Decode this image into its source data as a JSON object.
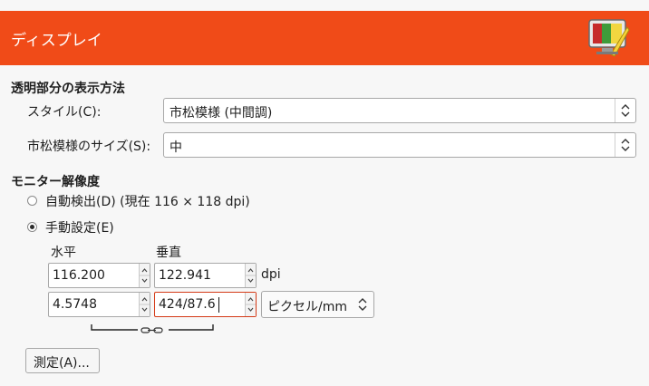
{
  "header": {
    "title": "ディスプレイ",
    "icon": "monitor-color-icon",
    "background": "#f04b18"
  },
  "transparency": {
    "section_title": "透明部分の表示方法",
    "style_label": "スタイル(C):",
    "style_value": "市松模様 (中間調)",
    "size_label": "市松模様のサイズ(S):",
    "size_value": "中"
  },
  "monitor": {
    "section_title": "モニター解像度",
    "auto_detect_label": "自動検出(D) (現在 116 × 118 dpi)",
    "auto_detect_checked": false,
    "manual_label": "手動設定(E)",
    "manual_checked": true,
    "horizontal_label": "水平",
    "vertical_label": "垂直",
    "horizontal_dpi": "116.200",
    "vertical_dpi": "122.941",
    "dpi_unit": "dpi",
    "horizontal_mm": "4.5748",
    "vertical_mm": "424/87.6",
    "unit_value": "ピクセル/mm",
    "chain_icon": "chain-link-icon",
    "calibrate_label": "測定(A)..."
  }
}
